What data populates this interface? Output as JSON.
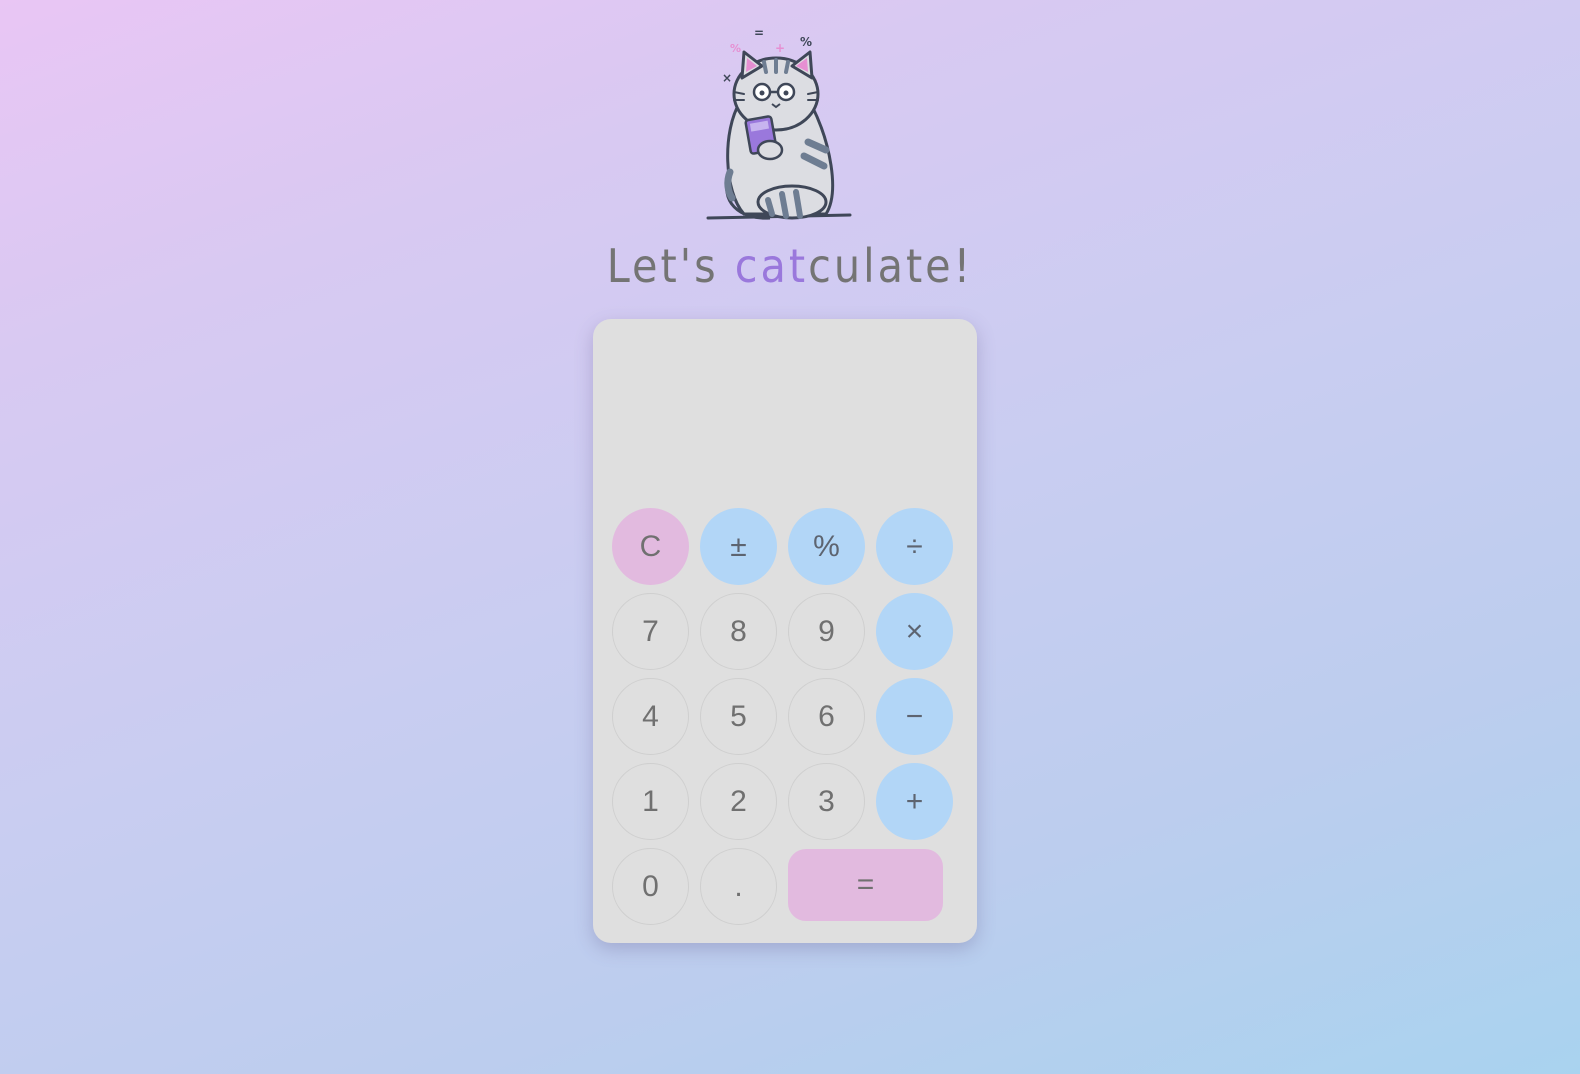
{
  "headline": {
    "part1": "Let's ",
    "accent": "cat",
    "part2": "culate!"
  },
  "mascot": {
    "icon": "cat-with-calculator-illustration",
    "floating_symbols": [
      "=",
      "%",
      "+",
      "÷",
      "×",
      "−"
    ]
  },
  "display": {
    "value": ""
  },
  "keys": {
    "clear": "C",
    "plus_minus": "±",
    "percent": "%",
    "divide": "÷",
    "seven": "7",
    "eight": "8",
    "nine": "9",
    "multiply": "×",
    "four": "4",
    "five": "5",
    "six": "6",
    "subtract": "−",
    "one": "1",
    "two": "2",
    "three": "3",
    "add": "+",
    "zero": "0",
    "decimal": ".",
    "equals": "="
  },
  "colors": {
    "accent_text": "#9a78dc",
    "operator_key": "#b2d6f7",
    "clear_equals_key": "#e2badf",
    "calculator_body": "#dfdfdf"
  }
}
